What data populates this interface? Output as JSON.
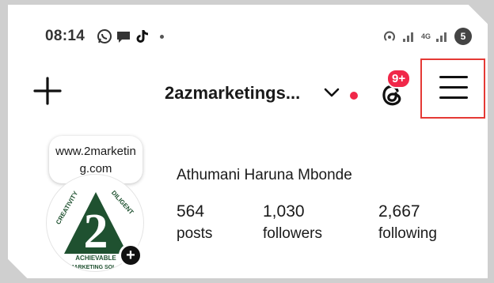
{
  "status_bar": {
    "time": "08:14",
    "network_label": "4G",
    "battery": "5"
  },
  "header": {
    "username": "2azmarketings...",
    "notification_badge": "9+",
    "accent_color": "#f02849"
  },
  "profile": {
    "note": "www.2marketing.com",
    "full_name": "Athumani Haruna Mbonde",
    "avatar_logo": {
      "number": "2",
      "arc_text_left": "CREATIVITY",
      "arc_text_right": "DILIGENT",
      "band_text_1": "ACHIEVABLE",
      "band_text_2": "MARKETING SOL"
    },
    "stats": [
      {
        "value": "564",
        "label": "posts"
      },
      {
        "value": "1,030",
        "label": "followers"
      },
      {
        "value": "2,667",
        "label": "following"
      }
    ]
  }
}
